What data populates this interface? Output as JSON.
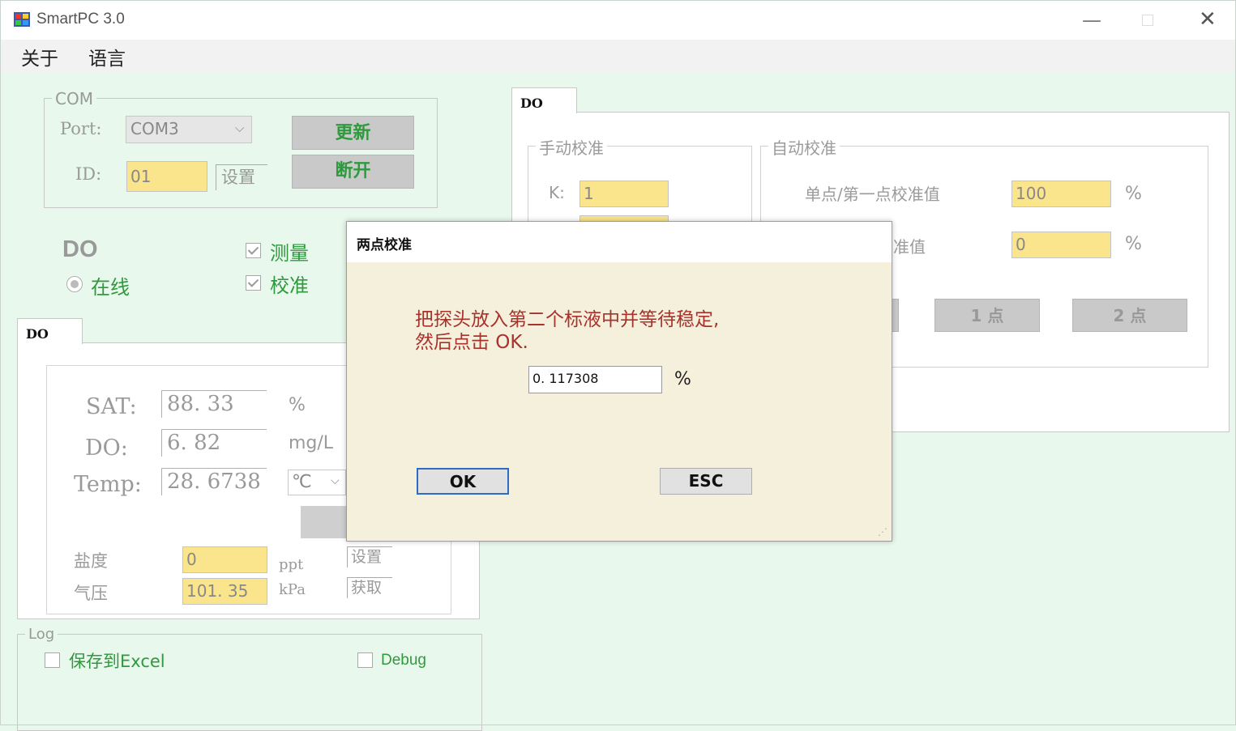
{
  "window": {
    "title": "SmartPC 3.0"
  },
  "menu": {
    "items": [
      "关于",
      "语言"
    ]
  },
  "com": {
    "legend": "COM",
    "port_label": "Port:",
    "port_value": "COM3",
    "id_label": "ID:",
    "id_value": "01",
    "set_label": "设置",
    "refresh_label": "更新",
    "disconnect_label": "断开"
  },
  "status": {
    "device": "DO",
    "online": "在线",
    "measure": "测量",
    "calibrate": "校准"
  },
  "left_tab": {
    "label": "DO"
  },
  "readings": {
    "sat_label": "SAT:",
    "sat_value": "88. 33",
    "sat_unit": "%",
    "do_label": "DO:",
    "do_value": "6. 82",
    "do_unit": "mg/L",
    "temp_label": "Temp:",
    "temp_value": "28. 6738",
    "temp_unit": "℃"
  },
  "salinity": {
    "label": "盐度",
    "value": "0",
    "unit": "ppt",
    "button": "设置"
  },
  "pressure": {
    "label": "气压",
    "value": "101. 35",
    "unit": "kPa",
    "button": "获取"
  },
  "log": {
    "legend": "Log",
    "excel": "保存到Excel",
    "debug": "Debug"
  },
  "right_tab": {
    "label": "DO"
  },
  "manual": {
    "legend": "手动校准",
    "k_label": "K:",
    "k_value": "1"
  },
  "auto": {
    "legend": "自动校准",
    "point1_label": "单点/第一点校准值",
    "point1_value": "100",
    "point1_unit": "%",
    "point2_label_visible": "准值",
    "point2_value": "0",
    "point2_unit": "%",
    "btn_1pt": "1 点",
    "btn_2pt": "2 点"
  },
  "dialog": {
    "title": "两点校准",
    "message_line1": "把探头放入第二个标液中并等待稳定,",
    "message_line2": "然后点击 OK.",
    "value": "0. 117308",
    "unit": "%",
    "ok": "OK",
    "esc": "ESC"
  },
  "colors": {
    "accent_green": "#2f9a3d",
    "field_yellow": "#fae58c",
    "message_red": "#a8322c",
    "background": "#e8f8ec"
  }
}
